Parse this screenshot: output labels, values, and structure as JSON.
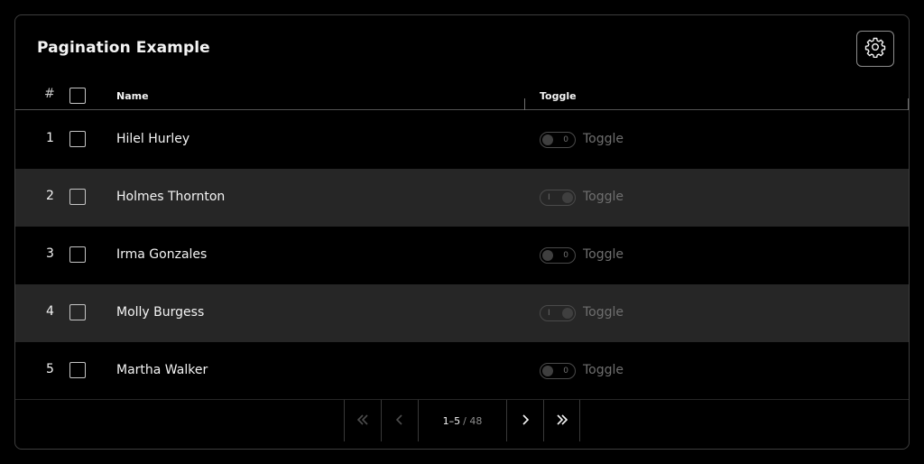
{
  "header": {
    "title": "Pagination Example"
  },
  "icons": {
    "settings": "gear-icon",
    "first": "double-chevron-left-icon",
    "prev": "chevron-left-icon",
    "next": "chevron-right-icon",
    "last": "double-chevron-right-icon"
  },
  "table": {
    "columns": {
      "index": "#",
      "name": "Name",
      "toggle": "Toggle"
    },
    "rows": [
      {
        "index": "1",
        "name": "Hilel Hurley",
        "toggle_label": "Toggle",
        "toggle_state": "off",
        "toggle_mark": "0"
      },
      {
        "index": "2",
        "name": "Holmes Thornton",
        "toggle_label": "Toggle",
        "toggle_state": "on",
        "toggle_mark": "I"
      },
      {
        "index": "3",
        "name": "Irma Gonzales",
        "toggle_label": "Toggle",
        "toggle_state": "off",
        "toggle_mark": "0"
      },
      {
        "index": "4",
        "name": "Molly Burgess",
        "toggle_label": "Toggle",
        "toggle_state": "on",
        "toggle_mark": "I"
      },
      {
        "index": "5",
        "name": "Martha Walker",
        "toggle_label": "Toggle",
        "toggle_state": "off",
        "toggle_mark": "0"
      }
    ]
  },
  "pagination": {
    "range": "1–5",
    "total": "/ 48"
  },
  "colors": {
    "background": "#000000",
    "alt_row": "#262626",
    "text": "#f4f4f4",
    "muted": "#6f6f6f",
    "border": "#3d3d3d"
  }
}
